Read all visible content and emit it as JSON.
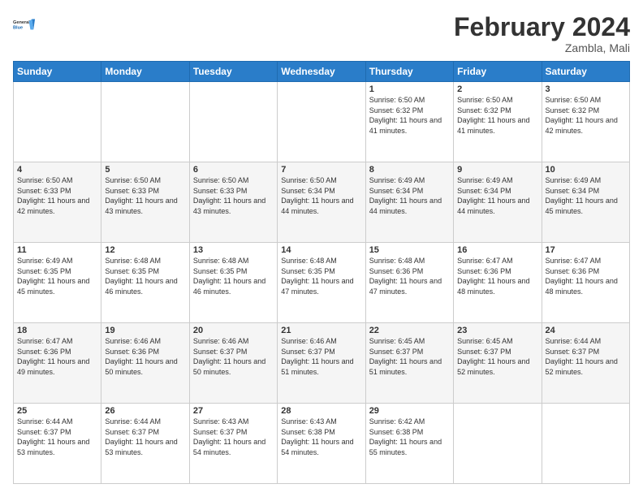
{
  "header": {
    "logo_general": "General",
    "logo_blue": "Blue",
    "title": "February 2024",
    "location": "Zambla, Mali"
  },
  "days_of_week": [
    "Sunday",
    "Monday",
    "Tuesday",
    "Wednesday",
    "Thursday",
    "Friday",
    "Saturday"
  ],
  "weeks": [
    [
      {
        "day": "",
        "sunrise": "",
        "sunset": "",
        "daylight": ""
      },
      {
        "day": "",
        "sunrise": "",
        "sunset": "",
        "daylight": ""
      },
      {
        "day": "",
        "sunrise": "",
        "sunset": "",
        "daylight": ""
      },
      {
        "day": "",
        "sunrise": "",
        "sunset": "",
        "daylight": ""
      },
      {
        "day": "1",
        "sunrise": "Sunrise: 6:50 AM",
        "sunset": "Sunset: 6:32 PM",
        "daylight": "Daylight: 11 hours and 41 minutes."
      },
      {
        "day": "2",
        "sunrise": "Sunrise: 6:50 AM",
        "sunset": "Sunset: 6:32 PM",
        "daylight": "Daylight: 11 hours and 41 minutes."
      },
      {
        "day": "3",
        "sunrise": "Sunrise: 6:50 AM",
        "sunset": "Sunset: 6:32 PM",
        "daylight": "Daylight: 11 hours and 42 minutes."
      }
    ],
    [
      {
        "day": "4",
        "sunrise": "Sunrise: 6:50 AM",
        "sunset": "Sunset: 6:33 PM",
        "daylight": "Daylight: 11 hours and 42 minutes."
      },
      {
        "day": "5",
        "sunrise": "Sunrise: 6:50 AM",
        "sunset": "Sunset: 6:33 PM",
        "daylight": "Daylight: 11 hours and 43 minutes."
      },
      {
        "day": "6",
        "sunrise": "Sunrise: 6:50 AM",
        "sunset": "Sunset: 6:33 PM",
        "daylight": "Daylight: 11 hours and 43 minutes."
      },
      {
        "day": "7",
        "sunrise": "Sunrise: 6:50 AM",
        "sunset": "Sunset: 6:34 PM",
        "daylight": "Daylight: 11 hours and 44 minutes."
      },
      {
        "day": "8",
        "sunrise": "Sunrise: 6:49 AM",
        "sunset": "Sunset: 6:34 PM",
        "daylight": "Daylight: 11 hours and 44 minutes."
      },
      {
        "day": "9",
        "sunrise": "Sunrise: 6:49 AM",
        "sunset": "Sunset: 6:34 PM",
        "daylight": "Daylight: 11 hours and 44 minutes."
      },
      {
        "day": "10",
        "sunrise": "Sunrise: 6:49 AM",
        "sunset": "Sunset: 6:34 PM",
        "daylight": "Daylight: 11 hours and 45 minutes."
      }
    ],
    [
      {
        "day": "11",
        "sunrise": "Sunrise: 6:49 AM",
        "sunset": "Sunset: 6:35 PM",
        "daylight": "Daylight: 11 hours and 45 minutes."
      },
      {
        "day": "12",
        "sunrise": "Sunrise: 6:48 AM",
        "sunset": "Sunset: 6:35 PM",
        "daylight": "Daylight: 11 hours and 46 minutes."
      },
      {
        "day": "13",
        "sunrise": "Sunrise: 6:48 AM",
        "sunset": "Sunset: 6:35 PM",
        "daylight": "Daylight: 11 hours and 46 minutes."
      },
      {
        "day": "14",
        "sunrise": "Sunrise: 6:48 AM",
        "sunset": "Sunset: 6:35 PM",
        "daylight": "Daylight: 11 hours and 47 minutes."
      },
      {
        "day": "15",
        "sunrise": "Sunrise: 6:48 AM",
        "sunset": "Sunset: 6:36 PM",
        "daylight": "Daylight: 11 hours and 47 minutes."
      },
      {
        "day": "16",
        "sunrise": "Sunrise: 6:47 AM",
        "sunset": "Sunset: 6:36 PM",
        "daylight": "Daylight: 11 hours and 48 minutes."
      },
      {
        "day": "17",
        "sunrise": "Sunrise: 6:47 AM",
        "sunset": "Sunset: 6:36 PM",
        "daylight": "Daylight: 11 hours and 48 minutes."
      }
    ],
    [
      {
        "day": "18",
        "sunrise": "Sunrise: 6:47 AM",
        "sunset": "Sunset: 6:36 PM",
        "daylight": "Daylight: 11 hours and 49 minutes."
      },
      {
        "day": "19",
        "sunrise": "Sunrise: 6:46 AM",
        "sunset": "Sunset: 6:36 PM",
        "daylight": "Daylight: 11 hours and 50 minutes."
      },
      {
        "day": "20",
        "sunrise": "Sunrise: 6:46 AM",
        "sunset": "Sunset: 6:37 PM",
        "daylight": "Daylight: 11 hours and 50 minutes."
      },
      {
        "day": "21",
        "sunrise": "Sunrise: 6:46 AM",
        "sunset": "Sunset: 6:37 PM",
        "daylight": "Daylight: 11 hours and 51 minutes."
      },
      {
        "day": "22",
        "sunrise": "Sunrise: 6:45 AM",
        "sunset": "Sunset: 6:37 PM",
        "daylight": "Daylight: 11 hours and 51 minutes."
      },
      {
        "day": "23",
        "sunrise": "Sunrise: 6:45 AM",
        "sunset": "Sunset: 6:37 PM",
        "daylight": "Daylight: 11 hours and 52 minutes."
      },
      {
        "day": "24",
        "sunrise": "Sunrise: 6:44 AM",
        "sunset": "Sunset: 6:37 PM",
        "daylight": "Daylight: 11 hours and 52 minutes."
      }
    ],
    [
      {
        "day": "25",
        "sunrise": "Sunrise: 6:44 AM",
        "sunset": "Sunset: 6:37 PM",
        "daylight": "Daylight: 11 hours and 53 minutes."
      },
      {
        "day": "26",
        "sunrise": "Sunrise: 6:44 AM",
        "sunset": "Sunset: 6:37 PM",
        "daylight": "Daylight: 11 hours and 53 minutes."
      },
      {
        "day": "27",
        "sunrise": "Sunrise: 6:43 AM",
        "sunset": "Sunset: 6:37 PM",
        "daylight": "Daylight: 11 hours and 54 minutes."
      },
      {
        "day": "28",
        "sunrise": "Sunrise: 6:43 AM",
        "sunset": "Sunset: 6:38 PM",
        "daylight": "Daylight: 11 hours and 54 minutes."
      },
      {
        "day": "29",
        "sunrise": "Sunrise: 6:42 AM",
        "sunset": "Sunset: 6:38 PM",
        "daylight": "Daylight: 11 hours and 55 minutes."
      },
      {
        "day": "",
        "sunrise": "",
        "sunset": "",
        "daylight": ""
      },
      {
        "day": "",
        "sunrise": "",
        "sunset": "",
        "daylight": ""
      }
    ]
  ]
}
